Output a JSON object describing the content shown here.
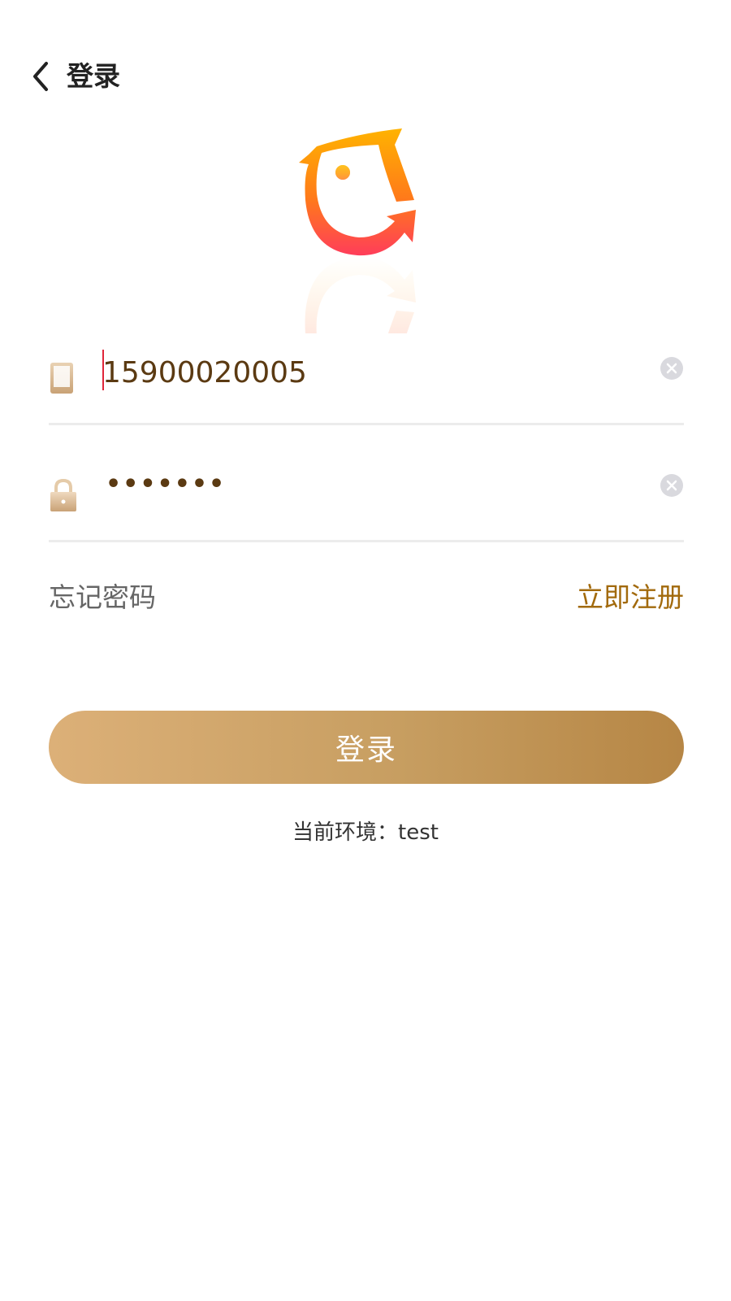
{
  "header": {
    "title": "登录",
    "back_icon": "chevron-left-icon"
  },
  "logo": {
    "name": "app-logo",
    "colors": [
      "#ffb300",
      "#ff7a1a",
      "#ff3d5a"
    ]
  },
  "form": {
    "phone": {
      "icon": "phone-icon",
      "value": "15900020005",
      "clear_icon": "clear-icon"
    },
    "password": {
      "icon": "lock-icon",
      "masked_value": "•••••••",
      "clear_icon": "clear-icon"
    }
  },
  "links": {
    "forgot_password": "忘记密码",
    "register": "立即注册"
  },
  "login_button": {
    "label": "登录"
  },
  "environment": {
    "text": "当前环境：test"
  },
  "colors": {
    "accent": "#a26a0c",
    "button_start": "#dcb078",
    "button_end": "#b68645",
    "input_text": "#5b3a12",
    "caret": "#e0263a"
  }
}
